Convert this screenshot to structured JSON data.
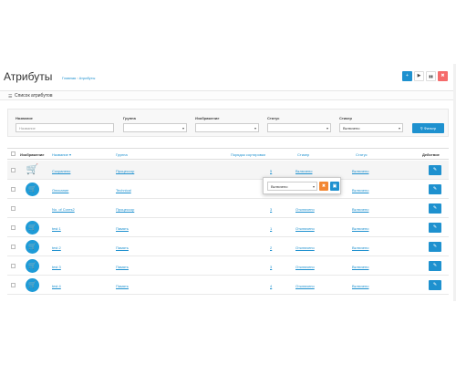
{
  "header": {
    "title": "Атрибуты",
    "breadcrumb": [
      "Главная",
      "Атрибуты"
    ],
    "buttons": [
      {
        "name": "add-button",
        "glyph": "+"
      },
      {
        "name": "run-button",
        "glyph": "▶"
      },
      {
        "name": "pause-button",
        "glyph": "▮▮"
      },
      {
        "name": "delete-button",
        "glyph": "🗑"
      }
    ]
  },
  "panel": {
    "title": "Список атрибутов"
  },
  "filters": {
    "name_label": "Название",
    "name_placeholder": "Название",
    "group_label": "Группа",
    "image_label": "Изображение",
    "status_label": "Статус",
    "sticker_label": "Стикер",
    "sticker_value": "Включено",
    "filter_button": "Фильтр"
  },
  "table": {
    "headers": {
      "image": "Изображение",
      "name": "Название",
      "group": "Группа",
      "sort": "Порядок сортировки",
      "sticker": "Стикер",
      "status": "Статус",
      "actions": "Действие"
    },
    "rows": [
      {
        "icon": "cart-gray-icon",
        "name": "Сохранено",
        "group": "Процессор",
        "sort": "5",
        "sticker": "Включено",
        "status": "Включено"
      },
      {
        "icon": "cart-blue-icon",
        "name": "Описание",
        "group": "Technical",
        "sort": "1",
        "sticker": "",
        "status": "Включено"
      },
      {
        "icon": "apple-icon",
        "name": "No. of Cores2",
        "group": "Процессор",
        "sort": "3",
        "sticker": "Отключено",
        "status": "Включено"
      },
      {
        "icon": "cart-blue-icon",
        "name": "test 1",
        "group": "Память",
        "sort": "1",
        "sticker": "Отключено",
        "status": "Включено"
      },
      {
        "icon": "cart-blue-icon",
        "name": "test 2",
        "group": "Память",
        "sort": "2",
        "sticker": "Отключено",
        "status": "Включено"
      },
      {
        "icon": "cart-blue-icon",
        "name": "test 3",
        "group": "Память",
        "sort": "3",
        "sticker": "Отключено",
        "status": "Включено"
      },
      {
        "icon": "cart-blue-icon",
        "name": "test 4",
        "group": "Память",
        "sort": "4",
        "sticker": "Отключено",
        "status": "Включено"
      }
    ]
  },
  "popup": {
    "select_value": "Включено"
  },
  "colors": {
    "accent": "#1e91cf",
    "danger": "#f56b6b",
    "orange": "#f38733"
  }
}
